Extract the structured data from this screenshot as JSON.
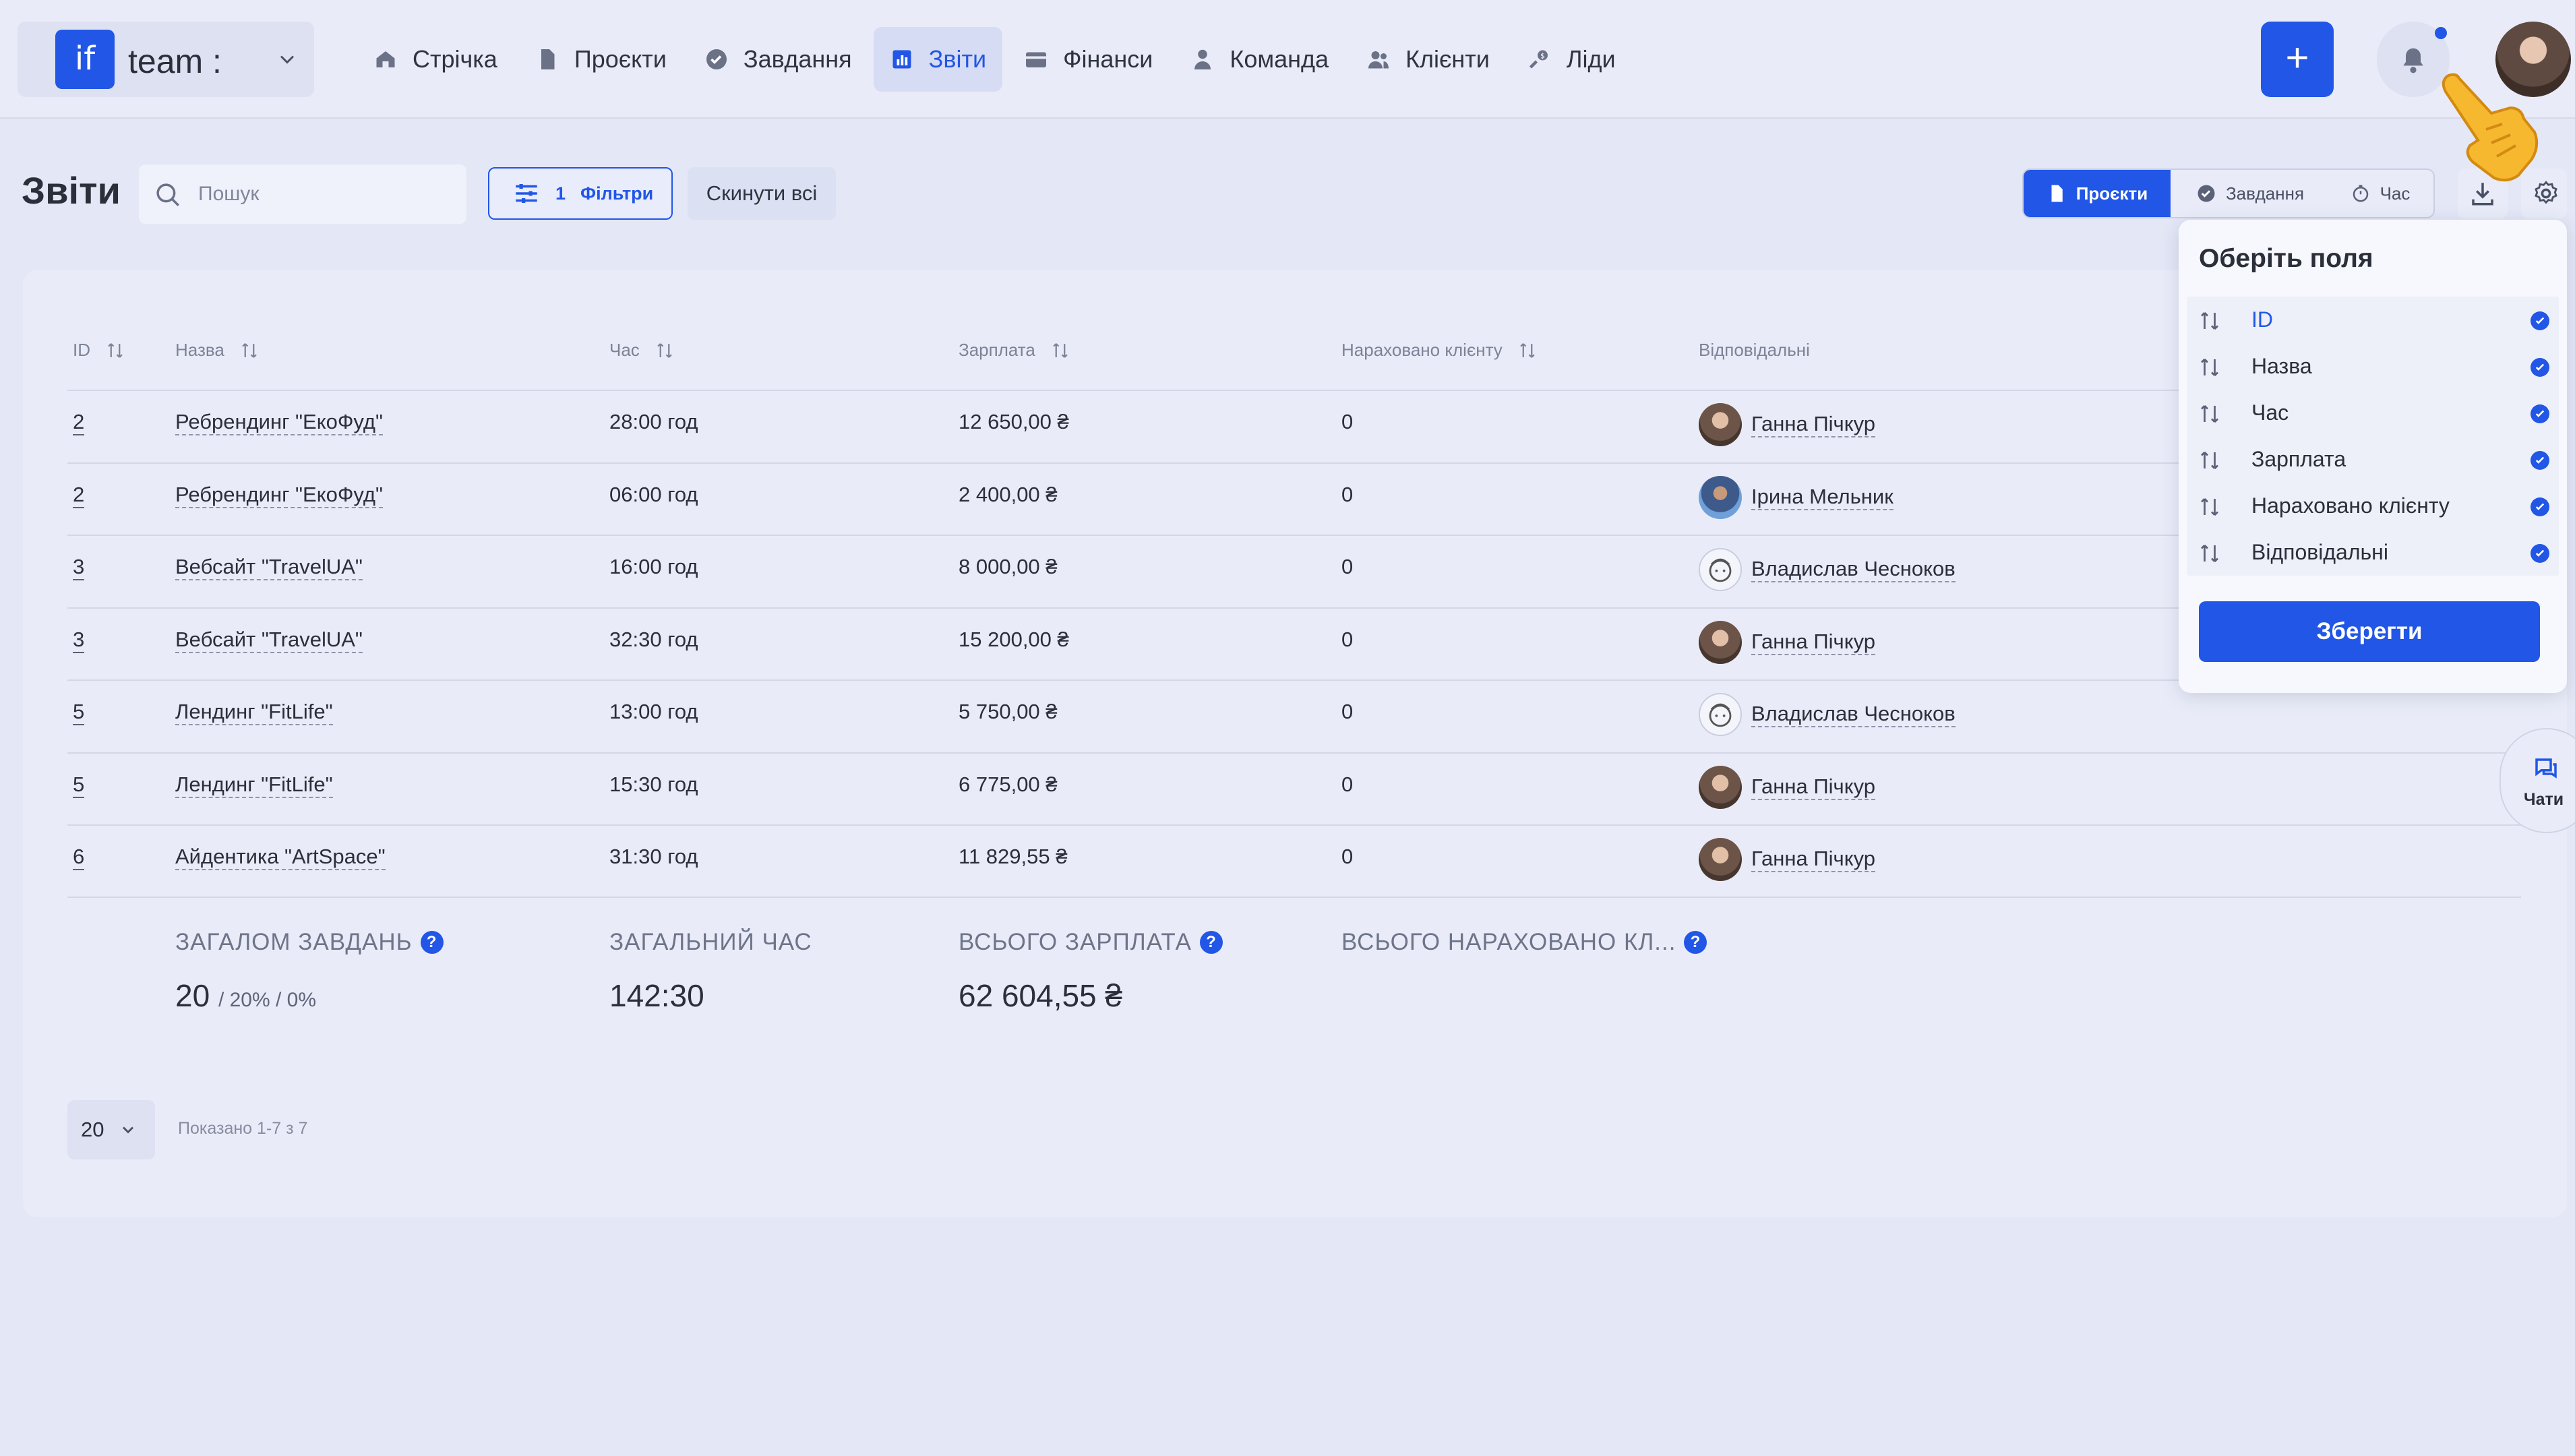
{
  "team": {
    "logo": "if",
    "name": "team :"
  },
  "nav": [
    {
      "label": "Стрічка",
      "icon": "home-icon"
    },
    {
      "label": "Проєкти",
      "icon": "file-icon"
    },
    {
      "label": "Завдання",
      "icon": "check-circle-icon"
    },
    {
      "label": "Звіти",
      "icon": "chart-icon",
      "active": true
    },
    {
      "label": "Фінанси",
      "icon": "wallet-icon"
    },
    {
      "label": "Команда",
      "icon": "person-icon"
    },
    {
      "label": "Клієнти",
      "icon": "people-icon"
    },
    {
      "label": "Ліди",
      "icon": "leads-icon"
    }
  ],
  "header": {
    "add_label": "+",
    "title": "Звіти",
    "search_placeholder": "Пошук",
    "filters_count": "1",
    "filters_label": "Фільтри",
    "reset_label": "Скинути всі",
    "views": [
      "Проєкти",
      "Завдання",
      "Час"
    ]
  },
  "table": {
    "columns": [
      "ID",
      "Назва",
      "Час",
      "Зарплата",
      "Нараховано клієнту",
      "Відповідальні"
    ],
    "rows": [
      {
        "id": "2",
        "name": "Ребрендинг \"ЕкоФуд\"",
        "time": "28:00 год",
        "salary": "12 650,00 ₴",
        "charged": "0",
        "resp": "Ганна Пічкур",
        "avatar": "a1"
      },
      {
        "id": "2",
        "name": "Ребрендинг \"ЕкоФуд\"",
        "time": "06:00 год",
        "salary": "2 400,00 ₴",
        "charged": "0",
        "resp": "Ірина Мельник",
        "avatar": "a2"
      },
      {
        "id": "3",
        "name": "Вебсайт \"TravelUA\"",
        "time": "16:00 год",
        "salary": "8 000,00 ₴",
        "charged": "0",
        "resp": "Владислав Чесноков",
        "avatar": "a3"
      },
      {
        "id": "3",
        "name": "Вебсайт \"TravelUA\"",
        "time": "32:30 год",
        "salary": "15 200,00 ₴",
        "charged": "0",
        "resp": "Ганна Пічкур",
        "avatar": "a1"
      },
      {
        "id": "5",
        "name": "Лендинг \"FitLife\"",
        "time": "13:00 год",
        "salary": "5 750,00 ₴",
        "charged": "0",
        "resp": "Владислав Чесноков",
        "avatar": "a3"
      },
      {
        "id": "5",
        "name": "Лендинг \"FitLife\"",
        "time": "15:30 год",
        "salary": "6 775,00 ₴",
        "charged": "0",
        "resp": "Ганна Пічкур",
        "avatar": "a1"
      },
      {
        "id": "6",
        "name": "Айдентика \"ArtSpace\"",
        "time": "31:30 год",
        "salary": "11 829,55 ₴",
        "charged": "0",
        "resp": "Ганна Пічкур",
        "avatar": "a1"
      }
    ]
  },
  "totals": {
    "tasks_label": "ЗАГАЛОМ ЗАВДАНЬ",
    "tasks_value": "20",
    "tasks_sub": "/ 20% / 0%",
    "time_label": "ЗАГАЛЬНИЙ ЧАС",
    "time_value": "142:30",
    "salary_label": "ВСЬОГО ЗАРПЛАТА",
    "salary_value": "62 604,55 ₴",
    "charged_label": "ВСЬОГО НАРАХОВАНО КЛ..."
  },
  "pagination": {
    "page_size": "20",
    "shown": "Показано 1-7 з 7"
  },
  "column_chooser": {
    "title": "Оберіть поля",
    "options": [
      "ID",
      "Назва",
      "Час",
      "Зарплата",
      "Нараховано клієнту",
      "Відповідальні"
    ],
    "save_label": "Зберегти"
  },
  "chat": {
    "label": "Чати"
  },
  "colors": {
    "accent": "#2156e6",
    "background": "#e3e7f6",
    "card": "#e9ecf8"
  }
}
